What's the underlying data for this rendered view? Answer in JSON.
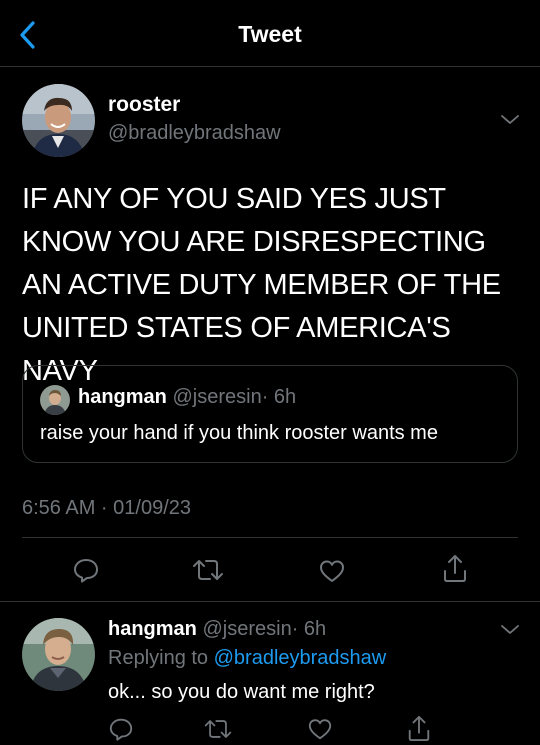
{
  "header": {
    "title": "Tweet",
    "back_icon": "chevron-left-icon"
  },
  "colors": {
    "accent": "#1d9bf0",
    "muted": "#71767b",
    "border": "#2f3336",
    "background": "#000000"
  },
  "main_tweet": {
    "display_name": "rooster",
    "handle": "@bradleybradshaw",
    "text": "IF ANY OF YOU SAID YES JUST KNOW YOU ARE DISRESPECTING AN ACTIVE DUTY MEMBER OF THE UNITED STATES OF AMERICA'S NAVY",
    "timestamp": "6:56 AM · 01/09/23",
    "quoted": {
      "display_name": "hangman",
      "handle": "@jseresin",
      "time": "· 6h",
      "text": "raise your hand if you think rooster wants me"
    },
    "actions": [
      "reply-icon",
      "retweet-icon",
      "like-icon",
      "share-icon"
    ]
  },
  "reply": {
    "display_name": "hangman",
    "handle": "@jseresin",
    "time": "· 6h",
    "replying_prefix": "Replying to",
    "replying_to": "@bradleybradshaw",
    "text": "ok... so you do want me right?"
  }
}
